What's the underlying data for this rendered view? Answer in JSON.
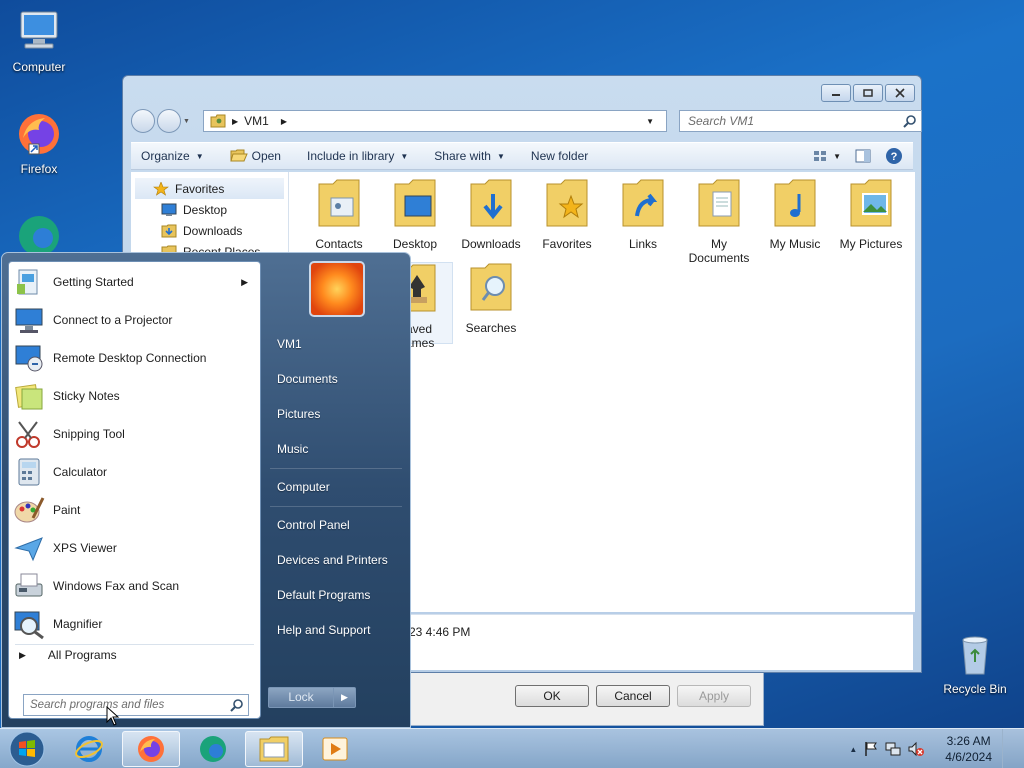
{
  "desktop": {
    "icons": [
      {
        "label": "Computer"
      },
      {
        "label": "Firefox"
      },
      {
        "label": "Recycle Bin"
      }
    ]
  },
  "explorer": {
    "address": {
      "path_segment": "VM1"
    },
    "search": {
      "placeholder": "Search VM1"
    },
    "toolbar": {
      "organize": "Organize",
      "open": "Open",
      "include_in_library": "Include in library",
      "share_with": "Share with",
      "new_folder": "New folder"
    },
    "nav_pane": {
      "favorites": "Favorites",
      "items": [
        "Desktop",
        "Downloads",
        "Recent Places"
      ]
    },
    "folders": [
      {
        "label": "Contacts"
      },
      {
        "label": "Desktop"
      },
      {
        "label": "Downloads"
      },
      {
        "label": "Favorites"
      },
      {
        "label": "Links"
      },
      {
        "label": "My Documents"
      },
      {
        "label": "My Music"
      },
      {
        "label": "My Pictures"
      },
      {
        "label": "Saved Games"
      },
      {
        "label": "Searches"
      }
    ],
    "details": {
      "date_fragment": "23 4:46 PM"
    }
  },
  "dialog": {
    "ok": "OK",
    "cancel": "Cancel",
    "apply": "Apply"
  },
  "start_menu": {
    "programs": [
      {
        "label": "Getting Started",
        "has_submenu": true
      },
      {
        "label": "Connect to a Projector"
      },
      {
        "label": "Remote Desktop Connection"
      },
      {
        "label": "Sticky Notes"
      },
      {
        "label": "Snipping Tool"
      },
      {
        "label": "Calculator"
      },
      {
        "label": "Paint"
      },
      {
        "label": "XPS Viewer"
      },
      {
        "label": "Windows Fax and Scan"
      },
      {
        "label": "Magnifier"
      }
    ],
    "all_programs": "All Programs",
    "search_placeholder": "Search programs and files",
    "right_links": [
      "VM1",
      "Documents",
      "Pictures",
      "Music",
      "Computer",
      "Control Panel",
      "Devices and Printers",
      "Default Programs",
      "Help and Support"
    ],
    "lock": "Lock"
  },
  "taskbar": {
    "clock_time": "3:26 AM",
    "clock_date": "4/6/2024"
  }
}
